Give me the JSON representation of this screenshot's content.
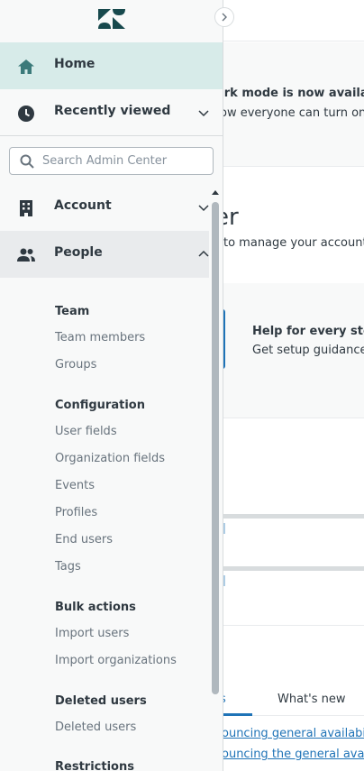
{
  "background": {
    "banner_title": "ark mode is now available",
    "banner_sub": "ow everyone can turn on d",
    "heading": "er",
    "heading_sub": "to manage your account,",
    "help_title": "Help for every step",
    "help_sub": "Get setup guidance,",
    "tabs": [
      {
        "label": "s"
      },
      {
        "label": "What's new"
      }
    ],
    "links": [
      "ouncing general availabili",
      "ouncing the general avail"
    ]
  },
  "sidebar": {
    "logo_icon": "zendesk-logo",
    "collapse_icon": "chevron-right-icon",
    "home": {
      "label": "Home",
      "icon": "home-icon"
    },
    "recently_viewed": {
      "label": "Recently viewed",
      "icon": "clock-icon"
    },
    "search": {
      "placeholder": "Search Admin Center",
      "value": ""
    },
    "account": {
      "label": "Account",
      "icon": "building-icon"
    },
    "people": {
      "label": "People",
      "icon": "people-icon",
      "sections": [
        {
          "heading": "Team",
          "links": [
            "Team members",
            "Groups"
          ]
        },
        {
          "heading": "Configuration",
          "links": [
            "User fields",
            "Organization fields",
            "Events",
            "Profiles",
            "End users",
            "Tags"
          ]
        },
        {
          "heading": "Bulk actions",
          "links": [
            "Import users",
            "Import organizations"
          ]
        },
        {
          "heading": "Deleted users",
          "links": [
            "Deleted users"
          ]
        },
        {
          "heading": "Restrictions",
          "links": []
        }
      ]
    }
  },
  "colors": {
    "accent": "#1f73b7",
    "home_active_bg": "#d7ebe9",
    "icon_teal": "#3b7a7a",
    "sidebar_bg": "#f8f9f9"
  }
}
